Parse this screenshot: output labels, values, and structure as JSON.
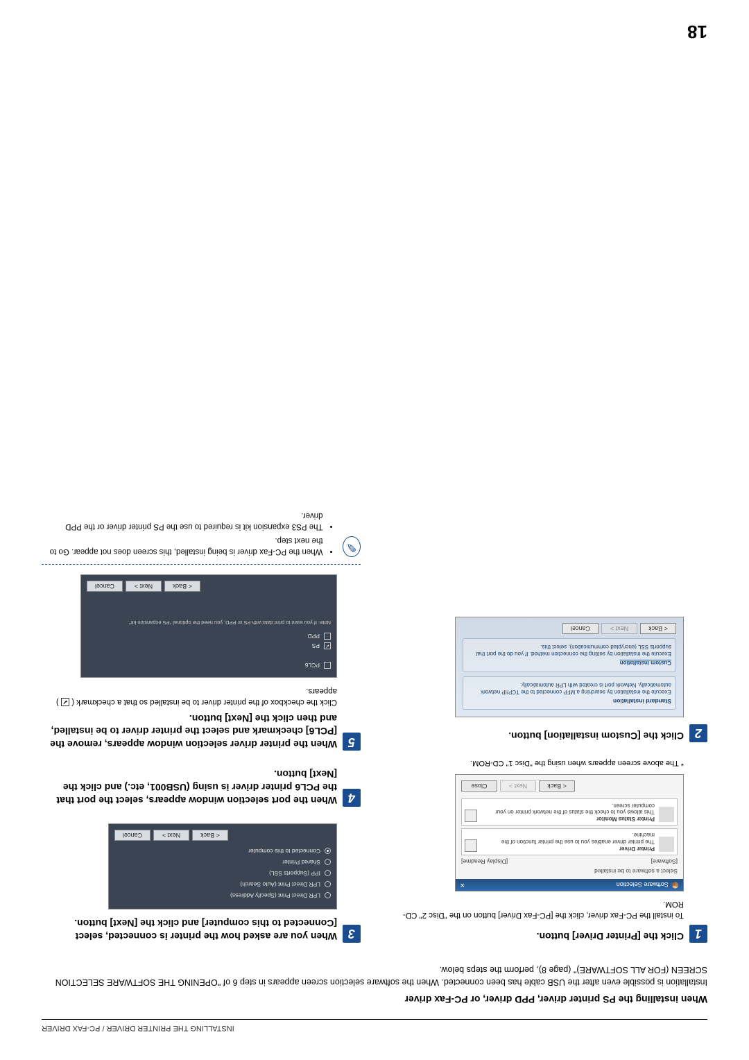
{
  "header": "INSTALLING THE PRINTER DRIVER / PC-FAX DRIVER",
  "sectionTitle": "When installing the PS printer driver, PPD driver, or PC-Fax driver",
  "intro": "Installation is possible even after the USB cable has been connected. When the software selection screen appears in step 6 of \"OPENING THE SOFTWARE SELECTION SCREEN (FOR ALL SOFTWARE)\" (page 8), perform the steps below.",
  "steps": {
    "s1": {
      "num": "1",
      "title": "Click the [Printer Driver] button.",
      "sub": "To install the PC-Fax driver, click the [PC-Fax Driver] button on the \"Disc 2\" CD-ROM."
    },
    "s2": {
      "num": "2",
      "title": "Click the [Custom installation] button."
    },
    "s3": {
      "num": "3",
      "title": "When you are asked how the printer is connected, select [Connected to this computer] and click the [Next] button."
    },
    "s4": {
      "num": "4",
      "title": "When the port selection window appears, select the port that the PCL6 printer driver is using (USB001, etc.) and click the [Next] button."
    },
    "s5": {
      "num": "5",
      "title": "When the printer driver selection window appears, remove the [PCL6] checkmark and select the printer driver to be installed, and then click the [Next] button.",
      "sub": "Click the checkbox of the printer driver to be installed so that a checkmark (  ✔  ) appears."
    }
  },
  "footnote": "* The above screen appears when using the \"Disc 1\" CD-ROM.",
  "shot1": {
    "title": "Software Selection",
    "heading": "Select a software to be installed",
    "tabSoftware": "[Software]",
    "tabReadme": "[Display Readme]",
    "row1Title": "Printer Driver",
    "row1Desc": "The printer driver enables you to use the printer function of the machine.",
    "row2Title": "Printer Status Monitor",
    "row2Desc": "This allows you to check the status of the network printer on your computer screen.",
    "back": "< Back",
    "next": "Next >",
    "close": "Close"
  },
  "shot2": {
    "panel1Title": "Standard installation",
    "panel1Desc": "Execute the installation by searching a MFP connected to the TCP/IP network automatically. Network port is created with LPR automatically.",
    "panel2Title": "Custom installation",
    "panel2Desc": "Execute the installation by setting the connection method. If you do the port that supports SSL (encrypted communication), select this.",
    "back": "< Back",
    "next": "Next >",
    "cancel": "Cancel"
  },
  "shot3": {
    "opt1": "LPR Direct Print (Specify Address)",
    "opt2": "LPR Direct Print (Auto Search)",
    "opt3": "IPP (Supports SSL)",
    "opt4": "Shared Printer",
    "opt5": "Connected to this computer",
    "back": "< Back",
    "next": "Next >",
    "cancel": "Cancel"
  },
  "shot5": {
    "pcl6": "PCL6",
    "ps": "PS",
    "ppd": "PPD",
    "note": "Note: If you want to print data with PS or PPD, you need the optional \"PS expansion kit\".",
    "back": "< Back",
    "next": "Next >",
    "cancel": "Cancel"
  },
  "notes": {
    "n1": "When the PC-Fax driver is being installed, this screen does not appear. Go to the next step.",
    "n2": "The PS3 expansion kit is required to use the PS printer driver or the PPD driver."
  },
  "pageNumber": "18"
}
